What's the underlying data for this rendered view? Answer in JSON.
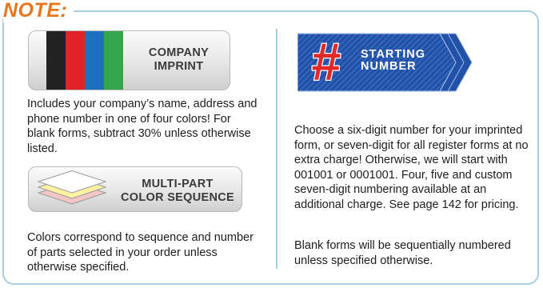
{
  "note": {
    "title": "NOTE:"
  },
  "company_imprint": {
    "label_line1": "COMPANY",
    "label_line2": "IMPRINT",
    "stripe_colors": [
      "#222222",
      "#e0242a",
      "#1d6fc2",
      "#34a54b"
    ],
    "description": "Includes your company’s name, address and phone number in one of four colors! For blank forms, subtract 30% unless otherwise listed."
  },
  "multi_part": {
    "label_line1": "MULTI-PART",
    "label_line2": "COLOR SEQUENCE",
    "sheet_colors": [
      "#f2c6c6",
      "#fff2a1",
      "#ffffff"
    ],
    "description": "Colors correspond to sequence and number of parts selected in your order unless otherwise specified."
  },
  "starting_number": {
    "symbol": "#",
    "label_line1": "STARTING",
    "label_line2": "NUMBER",
    "accent_color": "#e02a2a",
    "banner_color": "#2152a8",
    "description": "Choose a six-digit number for your imprinted form, or seven-digit for all register forms at no extra charge! Otherwise, we will start with 001001 or 0001001. Four, five and custom seven-digit numbering available at an additional charge. See page 142 for pricing.",
    "blank_note": "Blank forms will be sequentially numbered unless specified otherwise."
  }
}
